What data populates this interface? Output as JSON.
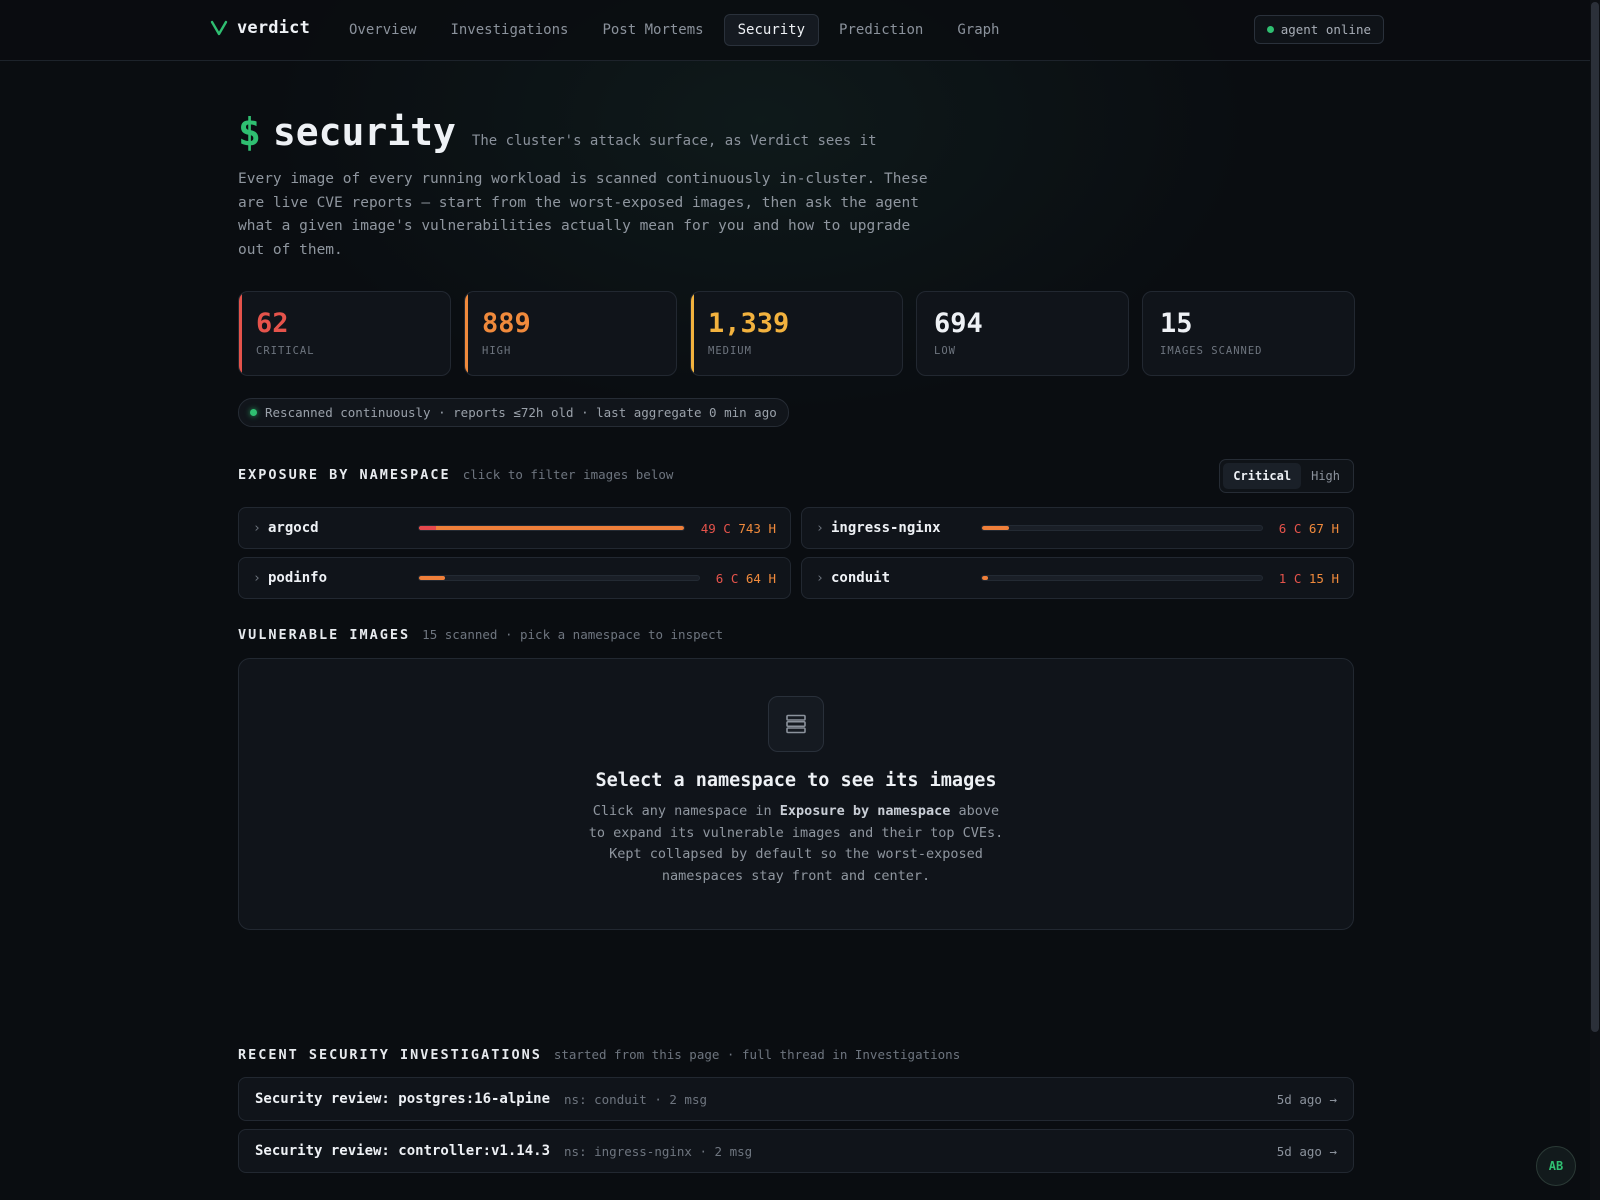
{
  "brand": {
    "name": "verdict"
  },
  "nav": {
    "items": [
      {
        "label": "Overview",
        "active": false
      },
      {
        "label": "Investigations",
        "active": false
      },
      {
        "label": "Post Mortems",
        "active": false
      },
      {
        "label": "Security",
        "active": true
      },
      {
        "label": "Prediction",
        "active": false
      },
      {
        "label": "Graph",
        "active": false
      }
    ],
    "status": "agent online"
  },
  "hero": {
    "prompt": "$",
    "title": "security",
    "subtitle": "The cluster's attack surface, as Verdict sees it",
    "lede": "Every image of every running workload is scanned continuously in-cluster. These are live CVE reports — start from the worst-exposed images, then ask the agent what a given image's vulnerabilities actually mean for you and how to upgrade out of them."
  },
  "stats": [
    {
      "value": "62",
      "label": "CRITICAL",
      "color": "#e5534b",
      "accent": "#e5534b"
    },
    {
      "value": "889",
      "label": "HIGH",
      "color": "#f08a3c",
      "accent": "#f08a3c"
    },
    {
      "value": "1,339",
      "label": "MEDIUM",
      "color": "#f2b23e",
      "accent": "#f2b23e"
    },
    {
      "value": "694",
      "label": "LOW",
      "color": "#eef1f5",
      "accent": ""
    },
    {
      "value": "15",
      "label": "IMAGES SCANNED",
      "color": "#eef1f5",
      "accent": ""
    }
  ],
  "rescan": {
    "text": "Rescanned continuously · reports ≤72h old · last aggregate 0 min ago"
  },
  "exposure": {
    "title": "EXPOSURE BY NAMESPACE",
    "subtitle": "click to filter images below",
    "toggle": [
      {
        "label": "Critical",
        "active": true
      },
      {
        "label": "High",
        "active": false
      }
    ],
    "namespaces": [
      {
        "name": "argocd",
        "critical": 49,
        "high": 743,
        "critical_label": "49 C",
        "high_label": "743 H",
        "fill": 1.0,
        "crit_fill": 0.066
      },
      {
        "name": "ingress-nginx",
        "critical": 6,
        "high": 67,
        "critical_label": "6 C",
        "high_label": "67 H",
        "fill": 0.098,
        "crit_fill": 0
      },
      {
        "name": "podinfo",
        "critical": 6,
        "high": 64,
        "critical_label": "6 C",
        "high_label": "64 H",
        "fill": 0.094,
        "crit_fill": 0
      },
      {
        "name": "conduit",
        "critical": 1,
        "high": 15,
        "critical_label": "1 C",
        "high_label": "15 H",
        "fill": 0.022,
        "crit_fill": 0
      }
    ]
  },
  "images": {
    "title": "VULNERABLE IMAGES",
    "subtitle": "15 scanned · pick a namespace to inspect",
    "empty_title": "Select a namespace to see its images",
    "empty_body_pre": "Click any namespace in ",
    "empty_body_bold": "Exposure by namespace",
    "empty_body_post": " above to expand its vulnerable images and their top CVEs. Kept collapsed by default so the worst-exposed namespaces stay front and center."
  },
  "investigations": {
    "title": "RECENT SECURITY INVESTIGATIONS",
    "subtitle": "started from this page · full thread in Investigations",
    "items": [
      {
        "title": "Security review: postgres:16-alpine",
        "meta": "ns: conduit · 2 msg",
        "when": "5d ago →"
      },
      {
        "title": "Security review: controller:v1.14.3",
        "meta": "ns: ingress-nginx · 2 msg",
        "when": "5d ago →"
      }
    ]
  },
  "user": {
    "initials": "AB"
  }
}
